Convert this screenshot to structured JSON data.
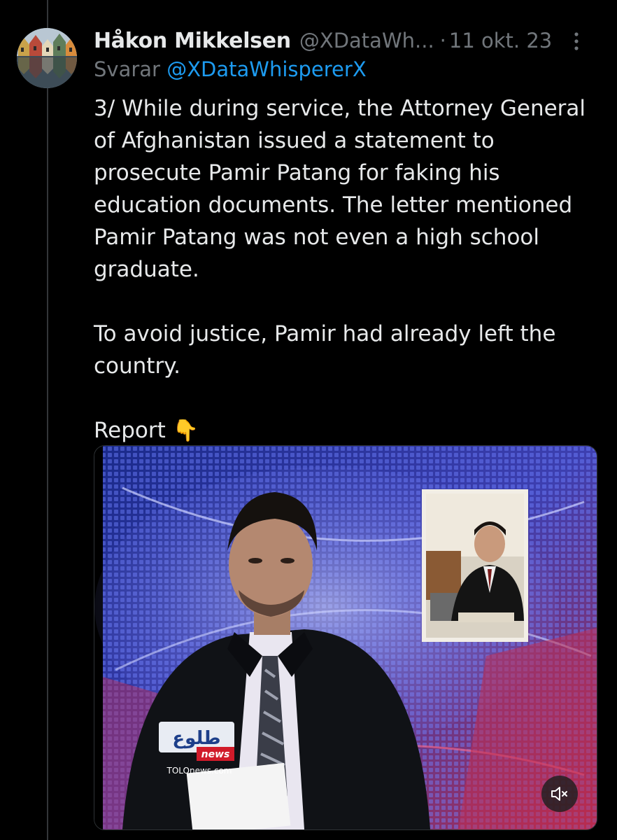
{
  "tweet": {
    "author_name": "Håkon Mikkelsen",
    "author_handle": "@XDataWh...",
    "separator": "·",
    "timestamp": "11 okt. 23",
    "reply_prefix": "Svarar",
    "reply_to": "@XDataWhispererX",
    "paragraphs": [
      "3/ While during service, the Attorney General of Afghanistan issued a statement to prosecute Pamir Patang for faking his education documents. The letter mentioned Pamir Patang was not even a high school graduate.",
      "To avoid justice, Pamir had already left the country.",
      "Report"
    ],
    "report_emoji": "👇"
  },
  "media": {
    "type": "video",
    "logo_text": "طلوع",
    "logo_news": "news",
    "logo_url": "TOLOnews.com",
    "mute_icon": "speaker-muted-icon"
  },
  "icons": {
    "more": "more-options-icon",
    "avatar": "avatar"
  },
  "colors": {
    "background": "#000000",
    "text": "#e7e9ea",
    "secondary": "#71767b",
    "link": "#1d9bf0",
    "thread_line": "#333639"
  }
}
